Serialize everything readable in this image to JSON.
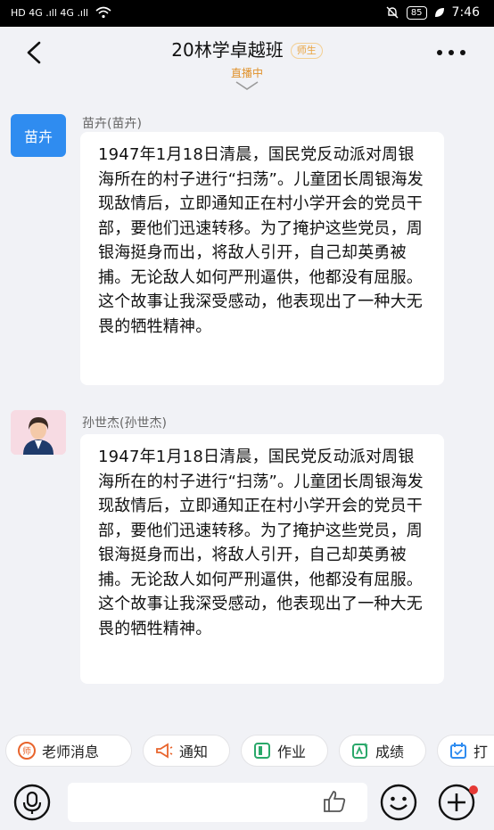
{
  "status_bar": {
    "left_text": "HD 4G .ıll 4G .ıll",
    "battery": "85",
    "time": "7:46"
  },
  "header": {
    "title": "20林学卓越班",
    "role_badge": "师生",
    "live_status": "直播中"
  },
  "messages": [
    {
      "sender": "苗卉(苗卉)",
      "avatar_text": "苗卉",
      "text": "1947年1月18日清晨，国民党反动派对周银海所在的村子进行“扫荡”。儿童团长周银海发现敌情后，立即通知正在村小学开会的党员干部，要他们迅速转移。为了掩护这些党员，周银海挺身而出，将敌人引开，自己却英勇被捕。无论敌人如何严刑逼供，他都没有屈服。这个故事让我深受感动，他表现出了一种大无畏的牺牲精神。"
    },
    {
      "sender": "孙世杰(孙世杰)",
      "avatar_text": "",
      "text": "1947年1月18日清晨，国民党反动派对周银海所在的村子进行“扫荡”。儿童团长周银海发现敌情后，立即通知正在村小学开会的党员干部，要他们迅速转移。为了掩护这些党员，周银海挺身而出，将敌人引开，自己却英勇被捕。无论敌人如何严刑逼供，他都没有屈服。这个故事让我深受感动，他表现出了一种大无畏的牺牲精神。"
    }
  ],
  "quick_actions": [
    {
      "label": "老师消息",
      "icon": "teacher-badge-icon",
      "color": "#e8642c"
    },
    {
      "label": "通知",
      "icon": "megaphone-icon",
      "color": "#e8642c"
    },
    {
      "label": "作业",
      "icon": "homework-icon",
      "color": "#2aa86a"
    },
    {
      "label": "成绩",
      "icon": "score-icon",
      "color": "#2aa86a"
    },
    {
      "label": "打",
      "icon": "checkin-icon",
      "color": "#2f8cf0"
    }
  ],
  "colors": {
    "accent_blue": "#2f8cf0",
    "live_orange": "#e0912a",
    "background": "#f1f2f6"
  }
}
